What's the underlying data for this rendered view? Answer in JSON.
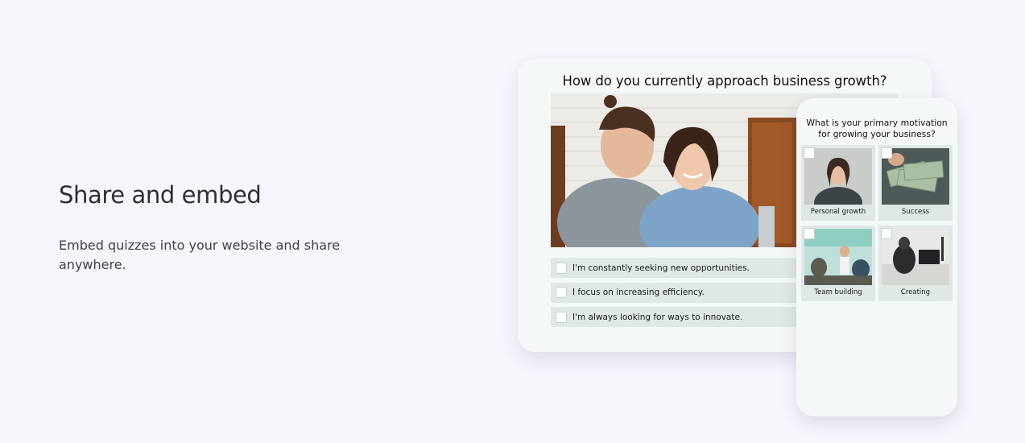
{
  "section": {
    "heading": "Share and embed",
    "description": "Embed quizzes into your website and share anywhere."
  },
  "desktop_quiz": {
    "question": "How do you currently approach business growth?",
    "options": [
      "I'm constantly seeking new opportunities.",
      "I focus on increasing efficiency.",
      "I'm always looking for ways to innovate."
    ]
  },
  "mobile_quiz": {
    "question": "What is your primary motivation for growing your business?",
    "choices": [
      "Personal growth",
      "Success",
      "Team building",
      "Creating"
    ]
  },
  "colors": {
    "background": "#f6f6fd",
    "card": "#f5f8f8",
    "option_bg": "#dfe8e6"
  }
}
